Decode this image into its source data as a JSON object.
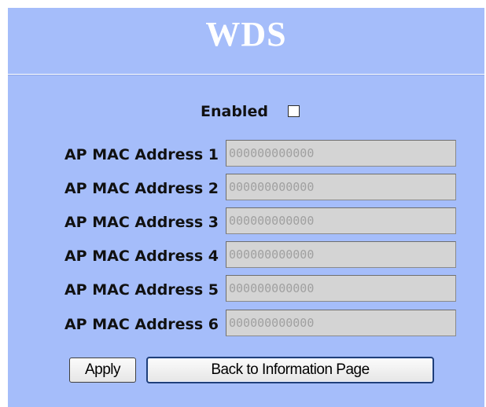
{
  "page": {
    "title": "WDS",
    "enabled_label": "Enabled",
    "enabled_checked": false
  },
  "mac_fields": [
    {
      "label": "AP MAC Address 1",
      "value": "000000000000"
    },
    {
      "label": "AP MAC Address 2",
      "value": "000000000000"
    },
    {
      "label": "AP MAC Address 3",
      "value": "000000000000"
    },
    {
      "label": "AP MAC Address 4",
      "value": "000000000000"
    },
    {
      "label": "AP MAC Address 5",
      "value": "000000000000"
    },
    {
      "label": "AP MAC Address 6",
      "value": "000000000000"
    }
  ],
  "buttons": {
    "apply_label": "Apply",
    "back_label": "Back to Information Page"
  },
  "colors": {
    "panel_background": "#a5bdfa",
    "title_color": "#ffffff",
    "input_disabled_background": "#d4d4d4",
    "input_disabled_text": "#a0a0a0"
  }
}
